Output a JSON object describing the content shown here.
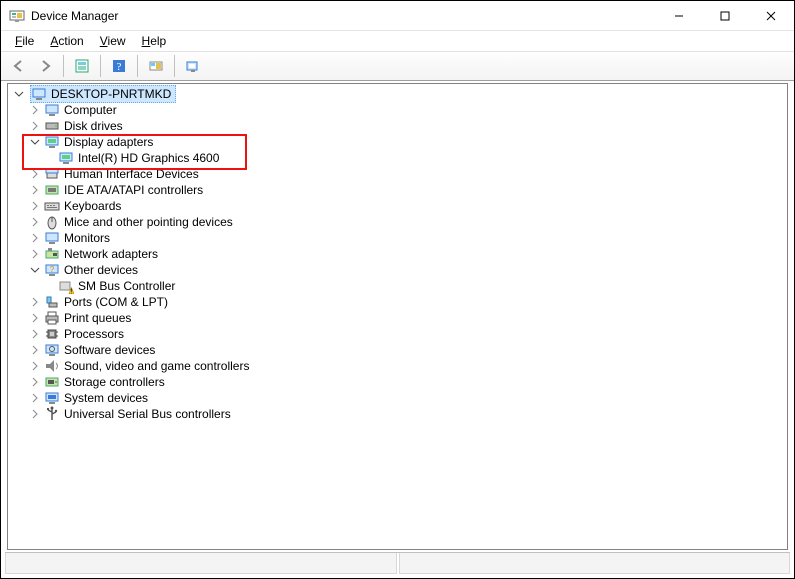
{
  "window": {
    "title": "Device Manager"
  },
  "menu": {
    "file": "File",
    "action": "Action",
    "view": "View",
    "help": "Help"
  },
  "toolbar": {
    "back": "Back",
    "forward": "Forward",
    "properties": "Properties",
    "help": "Help",
    "refresh": "Scan for hardware changes",
    "show": "Show hidden devices"
  },
  "tree": {
    "root": "DESKTOP-PNRTMKD",
    "computer": "Computer",
    "disk_drives": "Disk drives",
    "display_adapters": "Display adapters",
    "display_child": "Intel(R) HD Graphics 4600",
    "hid": "Human Interface Devices",
    "ide": "IDE ATA/ATAPI controllers",
    "keyboards": "Keyboards",
    "mice": "Mice and other pointing devices",
    "monitors": "Monitors",
    "network": "Network adapters",
    "other": "Other devices",
    "other_child": "SM Bus Controller",
    "ports": "Ports (COM & LPT)",
    "print_queues": "Print queues",
    "processors": "Processors",
    "software": "Software devices",
    "sound": "Sound, video and game controllers",
    "storage": "Storage controllers",
    "system": "System devices",
    "usb": "Universal Serial Bus controllers"
  }
}
